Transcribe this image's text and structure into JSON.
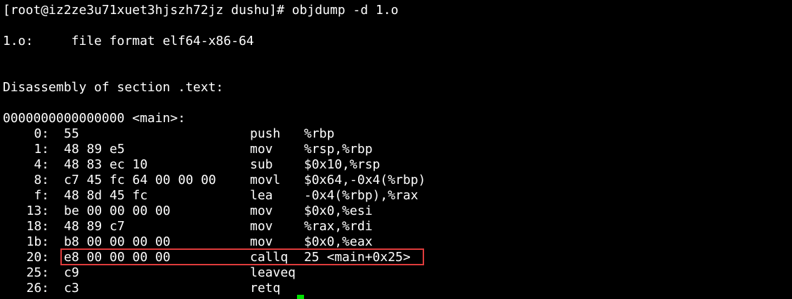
{
  "terminal": {
    "top_fragment": "[root@iz2ze3u71xuet3hjszh72jz dushu]# objdump -d 1.o",
    "prompt_line": "[root@iz2ze3u71xuet3hjszh72jz dushu]# objdump -d 1.o",
    "file_format_line": "1.o:     file format elf64-x86-64",
    "section_line": "Disassembly of section .text:",
    "symbol_line": "0000000000000000 <main>:",
    "colors": {
      "background": "#000000",
      "foreground": "#ffffff",
      "highlight_border": "#e03c3c",
      "cursor": "#00e000"
    },
    "instructions": [
      {
        "addr": "0:",
        "bytes": "55",
        "mnemonic": "push",
        "operands": "%rbp"
      },
      {
        "addr": "1:",
        "bytes": "48 89 e5",
        "mnemonic": "mov",
        "operands": "%rsp,%rbp"
      },
      {
        "addr": "4:",
        "bytes": "48 83 ec 10",
        "mnemonic": "sub",
        "operands": "$0x10,%rsp"
      },
      {
        "addr": "8:",
        "bytes": "c7 45 fc 64 00 00 00",
        "mnemonic": "movl",
        "operands": "$0x64,-0x4(%rbp)"
      },
      {
        "addr": "f:",
        "bytes": "48 8d 45 fc",
        "mnemonic": "lea",
        "operands": "-0x4(%rbp),%rax"
      },
      {
        "addr": "13:",
        "bytes": "be 00 00 00 00",
        "mnemonic": "mov",
        "operands": "$0x0,%esi"
      },
      {
        "addr": "18:",
        "bytes": "48 89 c7",
        "mnemonic": "mov",
        "operands": "%rax,%rdi"
      },
      {
        "addr": "1b:",
        "bytes": "b8 00 00 00 00",
        "mnemonic": "mov",
        "operands": "$0x0,%eax"
      },
      {
        "addr": "20:",
        "bytes": "e8 00 00 00 00",
        "mnemonic": "callq",
        "operands": "25 <main+0x25>"
      },
      {
        "addr": "25:",
        "bytes": "c9",
        "mnemonic": "leaveq",
        "operands": ""
      },
      {
        "addr": "26:",
        "bytes": "c3",
        "mnemonic": "retq",
        "operands": ""
      }
    ]
  }
}
